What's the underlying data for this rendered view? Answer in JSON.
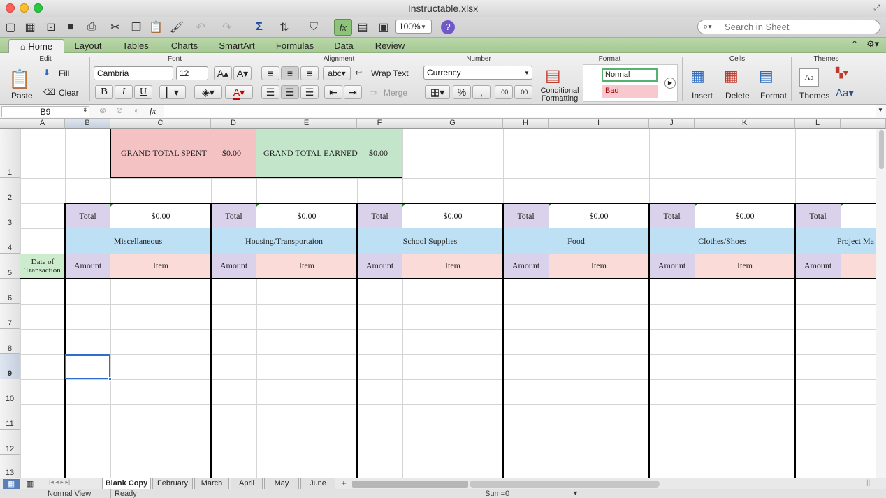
{
  "window": {
    "title": "Instructable.xlsx"
  },
  "toolbar": {
    "zoom": "100%",
    "search_placeholder": "Search in Sheet"
  },
  "ribbon_tabs": [
    "Home",
    "Layout",
    "Tables",
    "Charts",
    "SmartArt",
    "Formulas",
    "Data",
    "Review"
  ],
  "ribbon": {
    "groups": {
      "edit": "Edit",
      "font": "Font",
      "alignment": "Alignment",
      "number": "Number",
      "format": "Format",
      "cells": "Cells",
      "themes": "Themes"
    },
    "edit": {
      "paste": "Paste",
      "fill": "Fill",
      "clear": "Clear"
    },
    "font": {
      "name": "Cambria",
      "size": "12",
      "bold": "B",
      "italic": "I",
      "underline": "U",
      "grow": "A▴",
      "shrink": "A▾",
      "color": "A"
    },
    "alignment": {
      "abc": "abc",
      "wrap_text": "Wrap Text",
      "merge": "Merge"
    },
    "number": {
      "format": "Currency",
      "percent": "%",
      "comma": ",",
      "inc": ".00",
      "dec": ".00"
    },
    "format": {
      "conditional_line1": "Conditional",
      "conditional_line2": "Formatting",
      "style_normal": "Normal",
      "style_bad": "Bad"
    },
    "cells": {
      "insert": "Insert",
      "delete": "Delete",
      "format": "Format"
    },
    "themes": {
      "themes": "Themes",
      "aa": "Aa"
    }
  },
  "formula_bar": {
    "name_box": "B9",
    "fx": "fx",
    "value": ""
  },
  "columns": [
    "A",
    "B",
    "C",
    "D",
    "E",
    "F",
    "G",
    "H",
    "I",
    "J",
    "K",
    "L"
  ],
  "rows": [
    "1",
    "2",
    "3",
    "4",
    "5",
    "6",
    "7",
    "8",
    "9",
    "10",
    "11",
    "12",
    "13"
  ],
  "cells": {
    "grand_spent_label": "GRAND TOTAL SPENT",
    "grand_spent_value": "$0.00",
    "grand_earned_label": "GRAND TOTAL EARNED",
    "grand_earned_value": "$0.00",
    "date_header": "Date of Transaction",
    "categories": [
      {
        "total_label": "Total",
        "total_value": "$0.00",
        "name": "Miscellaneous",
        "amount": "Amount",
        "item": "Item"
      },
      {
        "total_label": "Total",
        "total_value": "$0.00",
        "name": "Housing/Transportaion",
        "amount": "Amount",
        "item": "Item"
      },
      {
        "total_label": "Total",
        "total_value": "$0.00",
        "name": "School Supplies",
        "amount": "Amount",
        "item": "Item"
      },
      {
        "total_label": "Total",
        "total_value": "$0.00",
        "name": "Food",
        "amount": "Amount",
        "item": "Item"
      },
      {
        "total_label": "Total",
        "total_value": "$0.00",
        "name": "Clothes/Shoes",
        "amount": "Amount",
        "item": "Item"
      },
      {
        "total_label": "Total",
        "total_value": "",
        "name": "Project Ma",
        "amount": "Amount",
        "item": ""
      }
    ]
  },
  "sheet_tabs": [
    "Blank Copy",
    "February",
    "March",
    "April",
    "May",
    "June"
  ],
  "status": {
    "view": "Normal View",
    "state": "Ready",
    "sum": "Sum=0"
  },
  "colors": {
    "spent": "#f4c2c2",
    "earned": "#c3e5c9",
    "total": "#d9d2ea",
    "category": "#bde0f5",
    "item": "#fbdbd8",
    "date": "#cdeccd"
  }
}
